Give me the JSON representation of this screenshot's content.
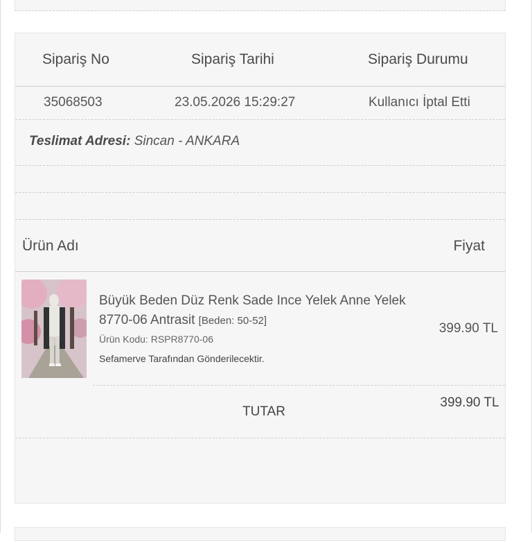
{
  "order": {
    "headers": {
      "no": "Sipariş No",
      "date": "Sipariş Tarihi",
      "status": "Sipariş Durumu"
    },
    "no": "35068503",
    "date": "23.05.2026 15:29:27",
    "status": "Kullanıcı İptal Etti",
    "address_label": "Teslimat Adresi:",
    "address_value": "Sincan - ANKARA"
  },
  "products": {
    "headers": {
      "name": "Ürün Adı",
      "price": "Fiyat"
    },
    "item": {
      "name": "Büyük Beden Düz Renk Sade Ince Yelek Anne Yelek 8770-06 Antrasit",
      "size": "[Beden: 50-52]",
      "code": "Ürün Kodu: RSPR8770-06",
      "shipper": "Sefamerve Tarafından Gönderilecektir.",
      "price": "399.90 TL"
    },
    "total_label": "TUTAR",
    "total_value": "399.90 TL"
  }
}
